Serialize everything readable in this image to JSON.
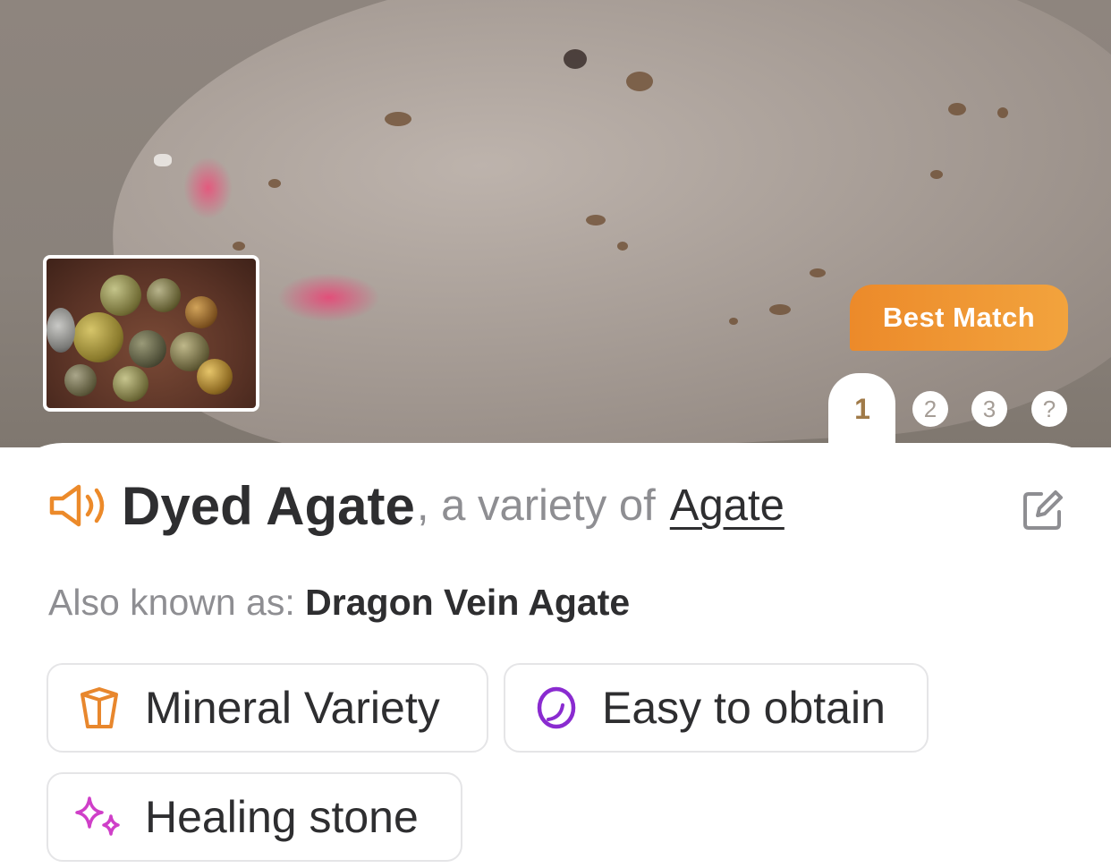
{
  "hero": {
    "badge_label": "Best Match",
    "pages": [
      "1",
      "2",
      "3",
      "?"
    ],
    "active_page": "1"
  },
  "result": {
    "name": "Dyed Agate",
    "variety_text": ", a variety of",
    "parent_link": "Agate",
    "aka_label": "Also known as:",
    "aka_value": "Dragon Vein Agate"
  },
  "tags": [
    {
      "label": "Mineral Variety",
      "icon": "crystal-icon",
      "color": "#e8872d"
    },
    {
      "label": "Easy to obtain",
      "icon": "stone-outline-icon",
      "color": "#8a2bd0"
    },
    {
      "label": "Healing stone",
      "icon": "sparkles-icon",
      "color": "#cf3fc8"
    }
  ],
  "colors": {
    "accent_orange": "#ec8a2a",
    "text_dark": "#2e2e30",
    "text_muted": "#8e8e92"
  }
}
